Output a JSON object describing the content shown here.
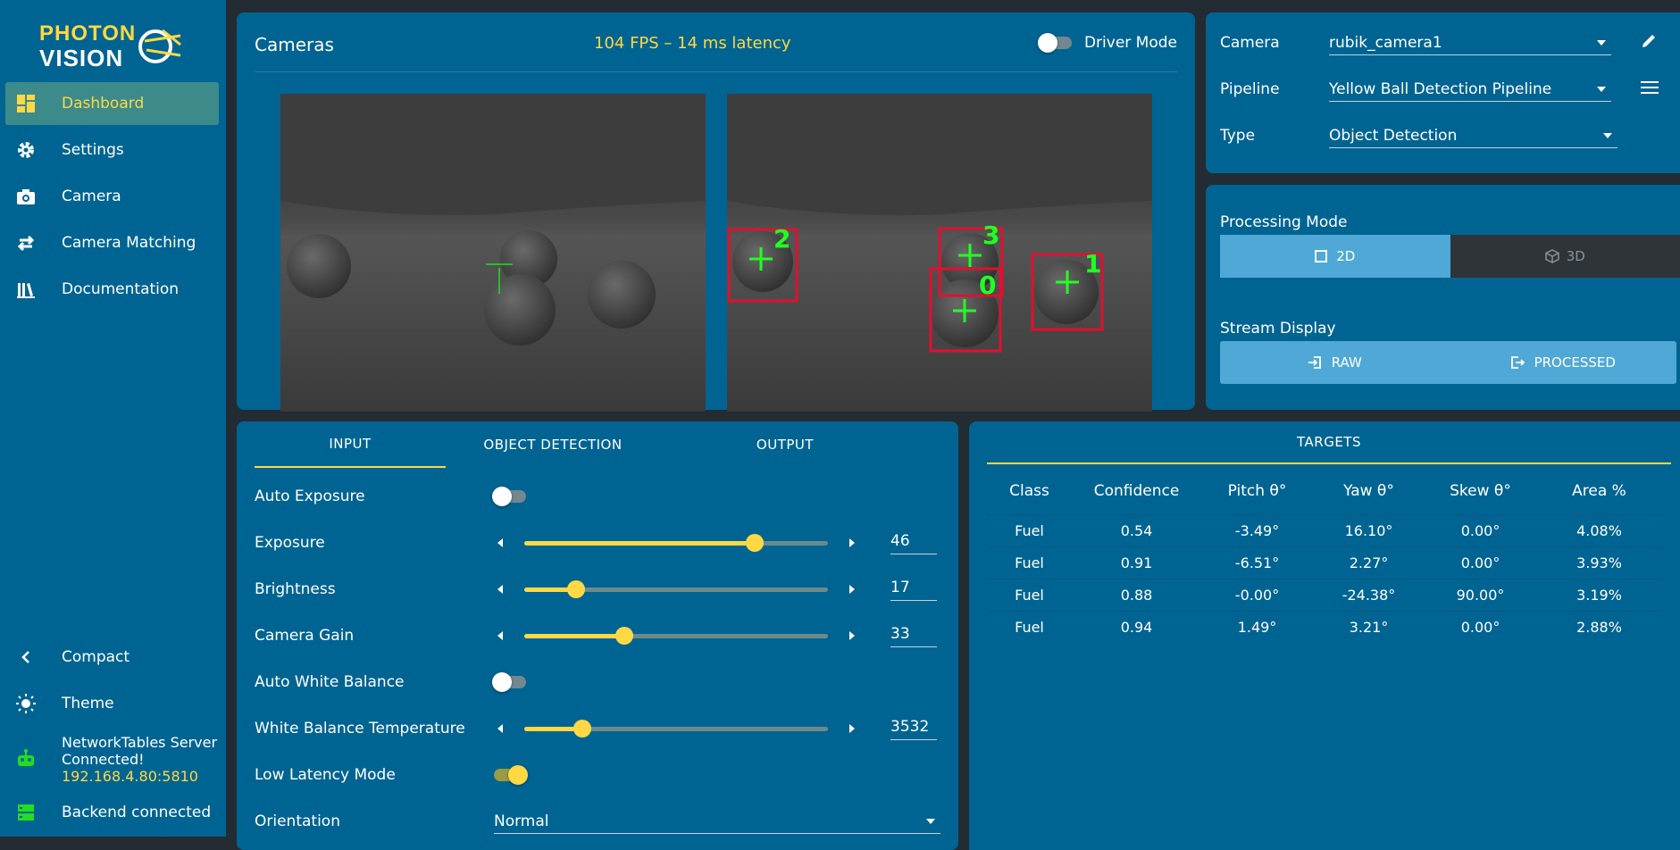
{
  "brand": {
    "line1": "PHOTON",
    "line2": "VISION"
  },
  "nav": {
    "items": [
      {
        "label": "Dashboard",
        "icon": "dashboard-icon",
        "active": true
      },
      {
        "label": "Settings",
        "icon": "gear-icon"
      },
      {
        "label": "Camera",
        "icon": "camera-icon"
      },
      {
        "label": "Camera Matching",
        "icon": "swap-arrows-icon"
      },
      {
        "label": "Documentation",
        "icon": "books-icon"
      }
    ]
  },
  "footer": {
    "compact": "Compact",
    "theme": "Theme",
    "nt_line1": "NetworkTables Server",
    "nt_line2": "Connected!",
    "nt_address": "192.168.4.80:5810",
    "backend": "Backend connected"
  },
  "cameras": {
    "title": "Cameras",
    "fps": "104 FPS – 14 ms latency",
    "driver_mode": "Driver Mode",
    "driver_mode_on": false,
    "targets": [
      {
        "label": "2"
      },
      {
        "label": "3"
      },
      {
        "label": "0"
      },
      {
        "label": "1"
      }
    ]
  },
  "config": {
    "camera_label": "Camera",
    "camera_value": "rubik_camera1",
    "pipeline_label": "Pipeline",
    "pipeline_value": "Yellow Ball Detection Pipeline",
    "type_label": "Type",
    "type_value": "Object Detection"
  },
  "processing": {
    "mode_label": "Processing Mode",
    "mode_2d": "2D",
    "mode_3d": "3D",
    "stream_label": "Stream Display",
    "raw": "RAW",
    "processed": "PROCESSED"
  },
  "tabs": [
    "INPUT",
    "OBJECT DETECTION",
    "OUTPUT"
  ],
  "input": {
    "auto_exposure": "Auto Exposure",
    "exposure": "Exposure",
    "exposure_value": "46",
    "exposure_pct": 0.76,
    "brightness": "Brightness",
    "brightness_value": "17",
    "brightness_pct": 0.17,
    "gain": "Camera Gain",
    "gain_value": "33",
    "gain_pct": 0.33,
    "auto_wb": "Auto White Balance",
    "wb_temp": "White Balance Temperature",
    "wb_temp_value": "3532",
    "wb_pct": 0.19,
    "low_latency": "Low Latency Mode",
    "orientation": "Orientation",
    "orientation_value": "Normal"
  },
  "targets": {
    "title": "TARGETS",
    "headers": [
      "Class",
      "Confidence",
      "Pitch θ°",
      "Yaw θ°",
      "Skew θ°",
      "Area %"
    ],
    "rows": [
      [
        "Fuel",
        "0.54",
        "-3.49°",
        "16.10°",
        "0.00°",
        "4.08%"
      ],
      [
        "Fuel",
        "0.91",
        "-6.51°",
        "2.27°",
        "0.00°",
        "3.93%"
      ],
      [
        "Fuel",
        "0.88",
        "-0.00°",
        "-24.38°",
        "90.00°",
        "3.19%"
      ],
      [
        "Fuel",
        "0.94",
        "1.49°",
        "3.21°",
        "0.00°",
        "2.88%"
      ]
    ]
  },
  "colors": {
    "accent": "#ffd843",
    "panel": "#006492",
    "bg": "#232b33",
    "segment_active": "#4fa8d6",
    "target_box": "#e0102e",
    "crosshair": "#22ee22"
  }
}
